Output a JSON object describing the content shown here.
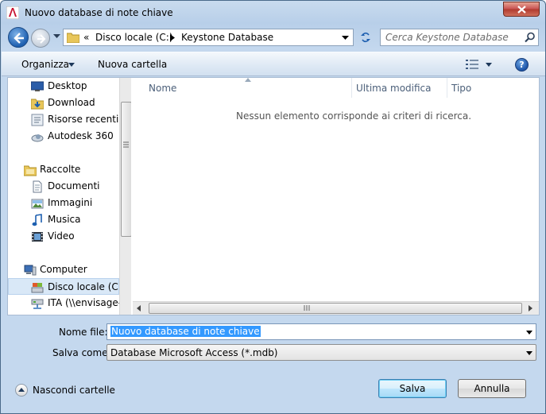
{
  "window": {
    "title": "Nuovo database di note chiave"
  },
  "address": {
    "overflow": "«",
    "segments": [
      "Disco locale (C:)",
      "Keystone Database"
    ]
  },
  "search": {
    "placeholder": "Cerca Keystone Database"
  },
  "toolbar": {
    "organize": "Organizza",
    "new_folder": "Nuova cartella",
    "help": "?"
  },
  "sidebar": {
    "items": [
      {
        "label": "Desktop",
        "icon": "desktop-icon"
      },
      {
        "label": "Download",
        "icon": "download-folder-icon"
      },
      {
        "label": "Risorse recenti",
        "icon": "recent-places-icon"
      },
      {
        "label": "Autodesk 360",
        "icon": "cloud-icon"
      },
      {
        "label": "Raccolte",
        "icon": "libraries-icon"
      },
      {
        "label": "Documenti",
        "icon": "documents-icon"
      },
      {
        "label": "Immagini",
        "icon": "pictures-icon"
      },
      {
        "label": "Musica",
        "icon": "music-icon"
      },
      {
        "label": "Video",
        "icon": "video-icon"
      },
      {
        "label": "Computer",
        "icon": "computer-icon"
      },
      {
        "label": "Disco locale (C:)",
        "icon": "local-disk-icon"
      },
      {
        "label": "ITA (\\\\envisage-s",
        "icon": "network-drive-icon"
      }
    ]
  },
  "filelist": {
    "columns": [
      "Nome",
      "Ultima modifica",
      "Tipo"
    ],
    "empty_message": "Nessun elemento corrisponde ai criteri di ricerca."
  },
  "form": {
    "filename_label": "Nome file:",
    "filename_value": "Nuovo database di note chiave",
    "savetype_label": "Salva come:",
    "savetype_value": "Database Microsoft Access (*.mdb)"
  },
  "footer": {
    "hide_folders": "Nascondi cartelle",
    "save_button": "Salva",
    "cancel_button": "Annulla"
  }
}
